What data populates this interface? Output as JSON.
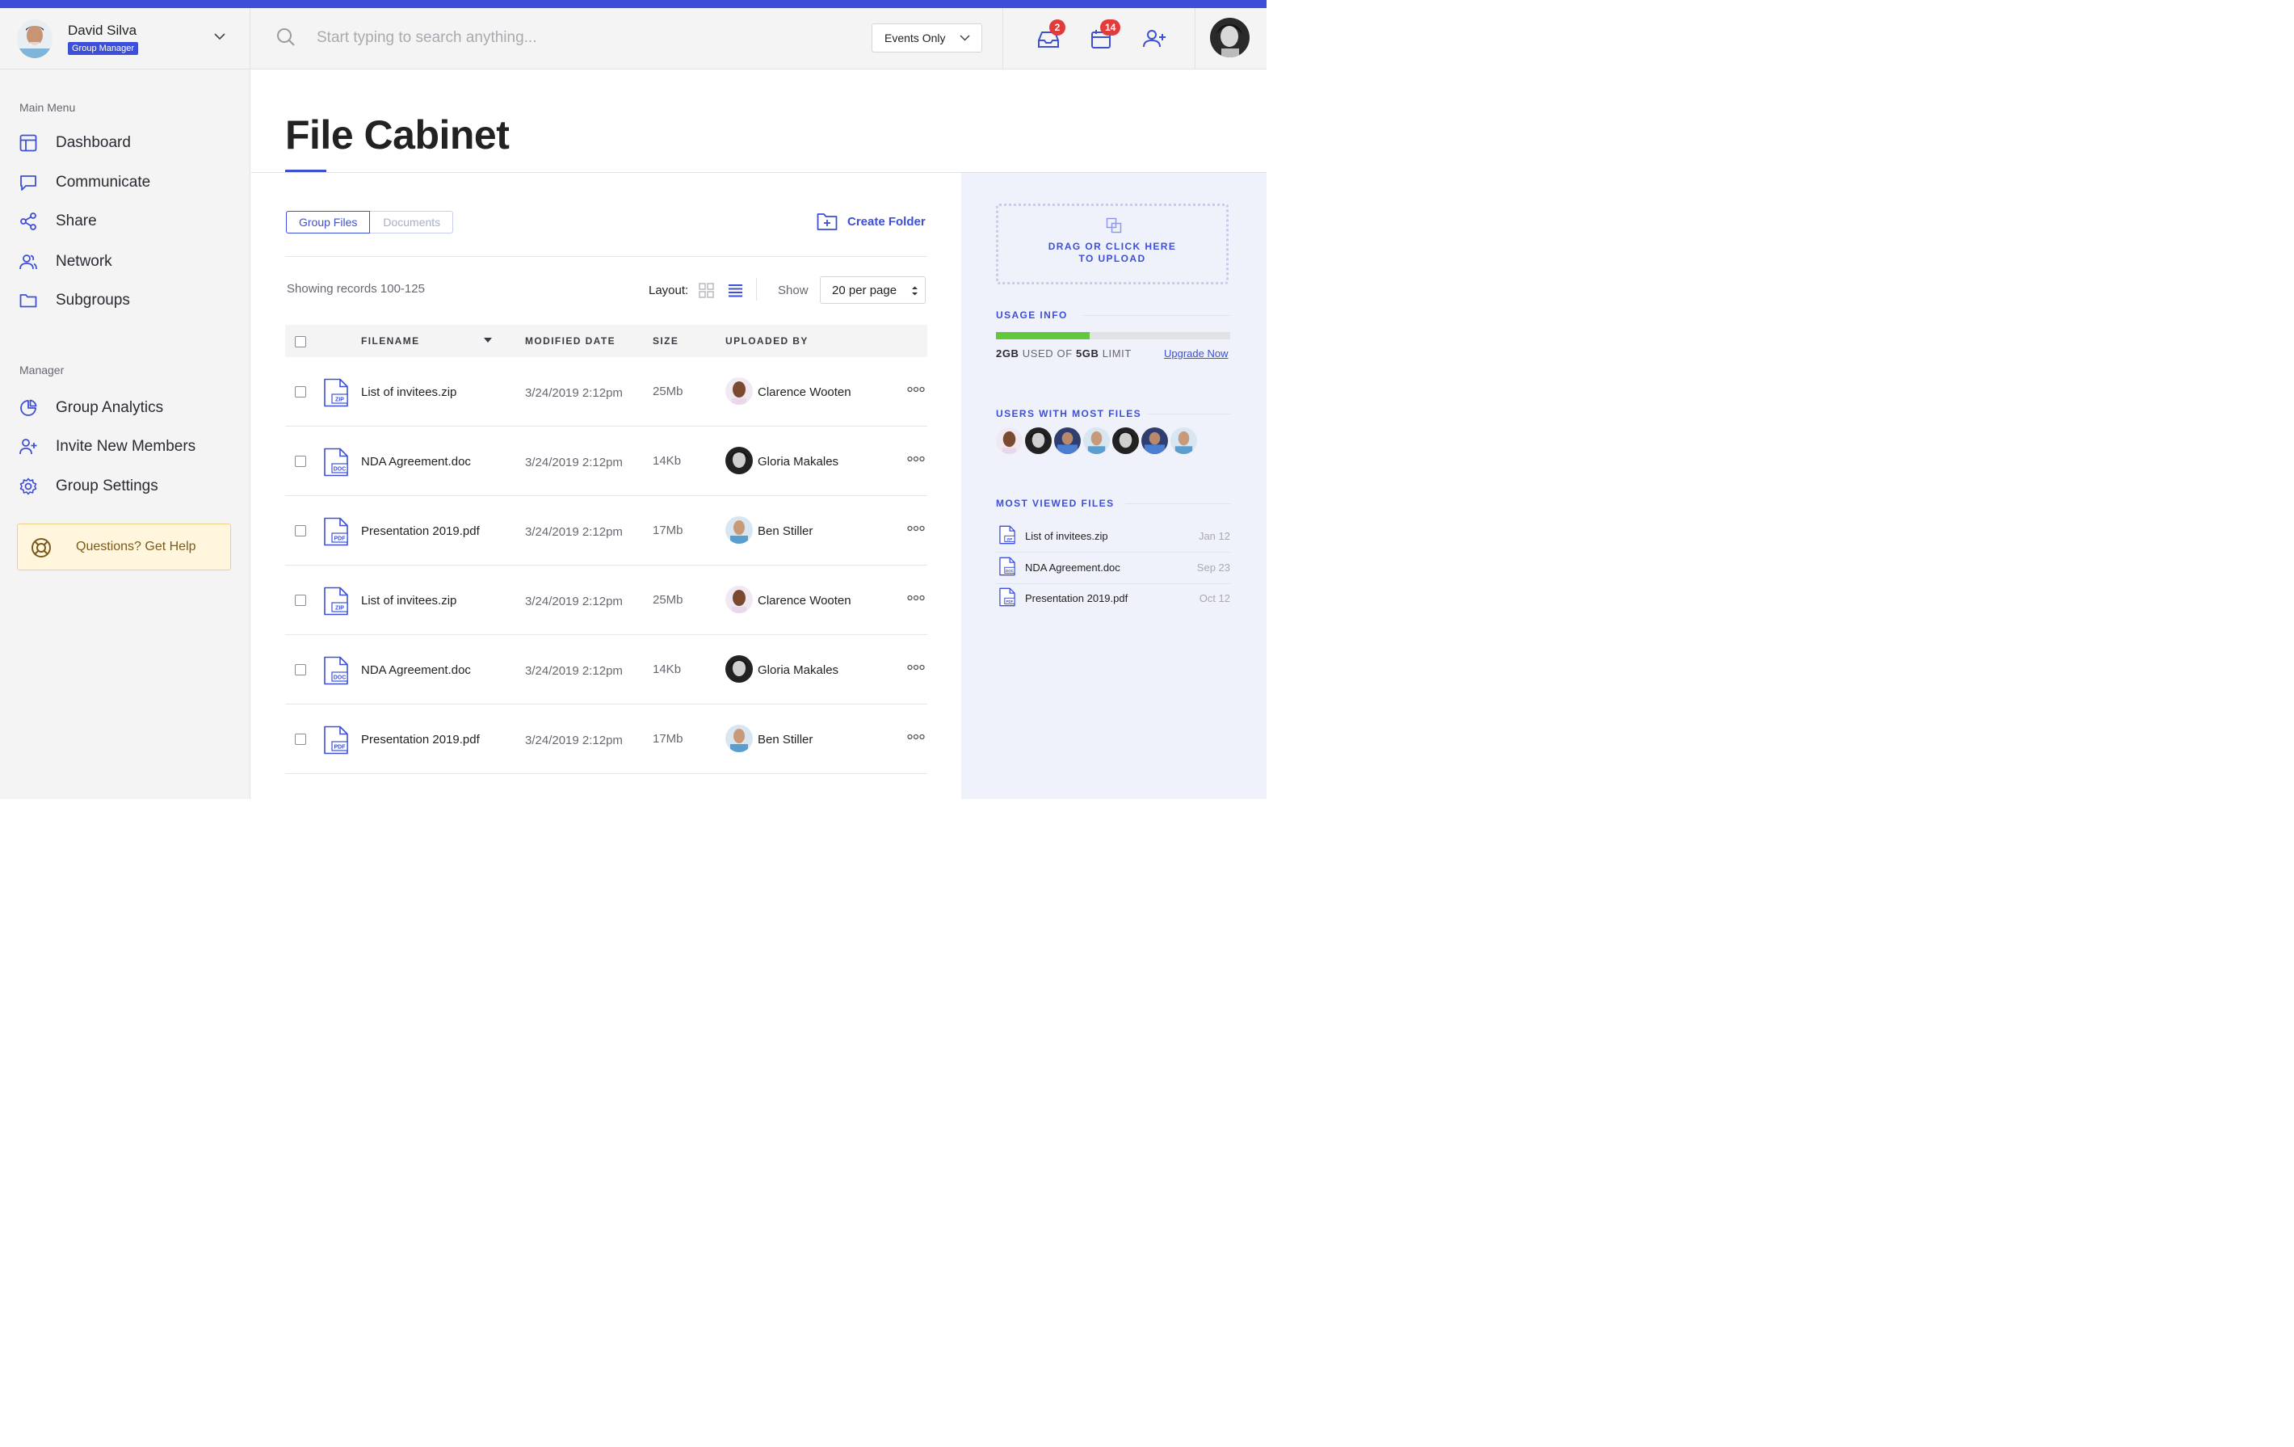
{
  "user": {
    "name": "David Silva",
    "role": "Group Manager"
  },
  "search": {
    "placeholder": "Start typing to search anything..."
  },
  "filter": {
    "selected": "Events Only"
  },
  "notifications": {
    "inbox_count": "2",
    "calendar_count": "14"
  },
  "sidebar": {
    "main_menu_label": "Main Menu",
    "main_items": [
      {
        "label": "Dashboard",
        "icon": "layout-icon"
      },
      {
        "label": "Communicate",
        "icon": "chat-icon"
      },
      {
        "label": "Share",
        "icon": "share-icon"
      },
      {
        "label": "Network",
        "icon": "users-icon"
      },
      {
        "label": "Subgroups",
        "icon": "folder-icon"
      }
    ],
    "manager_label": "Manager",
    "manager_items": [
      {
        "label": "Group Analytics",
        "icon": "pie-chart-icon"
      },
      {
        "label": "Invite New Members",
        "icon": "user-plus-icon"
      },
      {
        "label": "Group Settings",
        "icon": "gear-icon"
      }
    ],
    "help_label": "Questions? Get Help"
  },
  "page": {
    "title": "File Cabinet"
  },
  "tabs": [
    {
      "label": "Group Files",
      "active": true
    },
    {
      "label": "Documents",
      "active": false
    }
  ],
  "actions": {
    "create_folder": "Create Folder"
  },
  "toolbar": {
    "records": "Showing records 100-125",
    "layout_label": "Layout:",
    "show_label": "Show",
    "per_page": "20 per page"
  },
  "table": {
    "columns": [
      "FILENAME",
      "MODIFIED DATE",
      "SIZE",
      "UPLOADED BY"
    ],
    "rows": [
      {
        "filename": "List of invitees.zip",
        "type": "ZIP",
        "modified": "3/24/2019 2:12pm",
        "size": "25Mb",
        "uploader": "Clarence Wooten"
      },
      {
        "filename": "NDA Agreement.doc",
        "type": "DOC",
        "modified": "3/24/2019 2:12pm",
        "size": "14Kb",
        "uploader": "Gloria Makales"
      },
      {
        "filename": "Presentation 2019.pdf",
        "type": "PDF",
        "modified": "3/24/2019 2:12pm",
        "size": "17Mb",
        "uploader": "Ben Stiller"
      },
      {
        "filename": "List of invitees.zip",
        "type": "ZIP",
        "modified": "3/24/2019 2:12pm",
        "size": "25Mb",
        "uploader": "Clarence Wooten"
      },
      {
        "filename": "NDA Agreement.doc",
        "type": "DOC",
        "modified": "3/24/2019 2:12pm",
        "size": "14Kb",
        "uploader": "Gloria Makales"
      },
      {
        "filename": "Presentation 2019.pdf",
        "type": "PDF",
        "modified": "3/24/2019 2:12pm",
        "size": "17Mb",
        "uploader": "Ben Stiller"
      }
    ]
  },
  "upload": {
    "text_line1": "DRAG OR CLICK HERE",
    "text_line2": "TO UPLOAD"
  },
  "usage": {
    "heading": "USAGE INFO",
    "used": "2GB",
    "used_of": "USED OF",
    "limit": "5GB",
    "limit_label": "LIMIT",
    "used_fraction": 0.4,
    "upgrade_label": "Upgrade Now"
  },
  "top_users": {
    "heading": "USERS WITH MOST FILES"
  },
  "most_viewed": {
    "heading": "MOST VIEWED FILES",
    "items": [
      {
        "name": "List of invitees.zip",
        "type": "ZIP",
        "date": "Jan 12"
      },
      {
        "name": "NDA Agreement.doc",
        "type": "DOC",
        "date": "Sep 23"
      },
      {
        "name": "Presentation 2019.pdf",
        "type": "PDF",
        "date": "Oct 12"
      }
    ]
  },
  "colors": {
    "accent": "#3d4fd6",
    "badge": "#e23b3b",
    "usage_fill": "#60c83c",
    "help_bg": "#fff6dd",
    "panel_bg": "#eff2fb"
  }
}
